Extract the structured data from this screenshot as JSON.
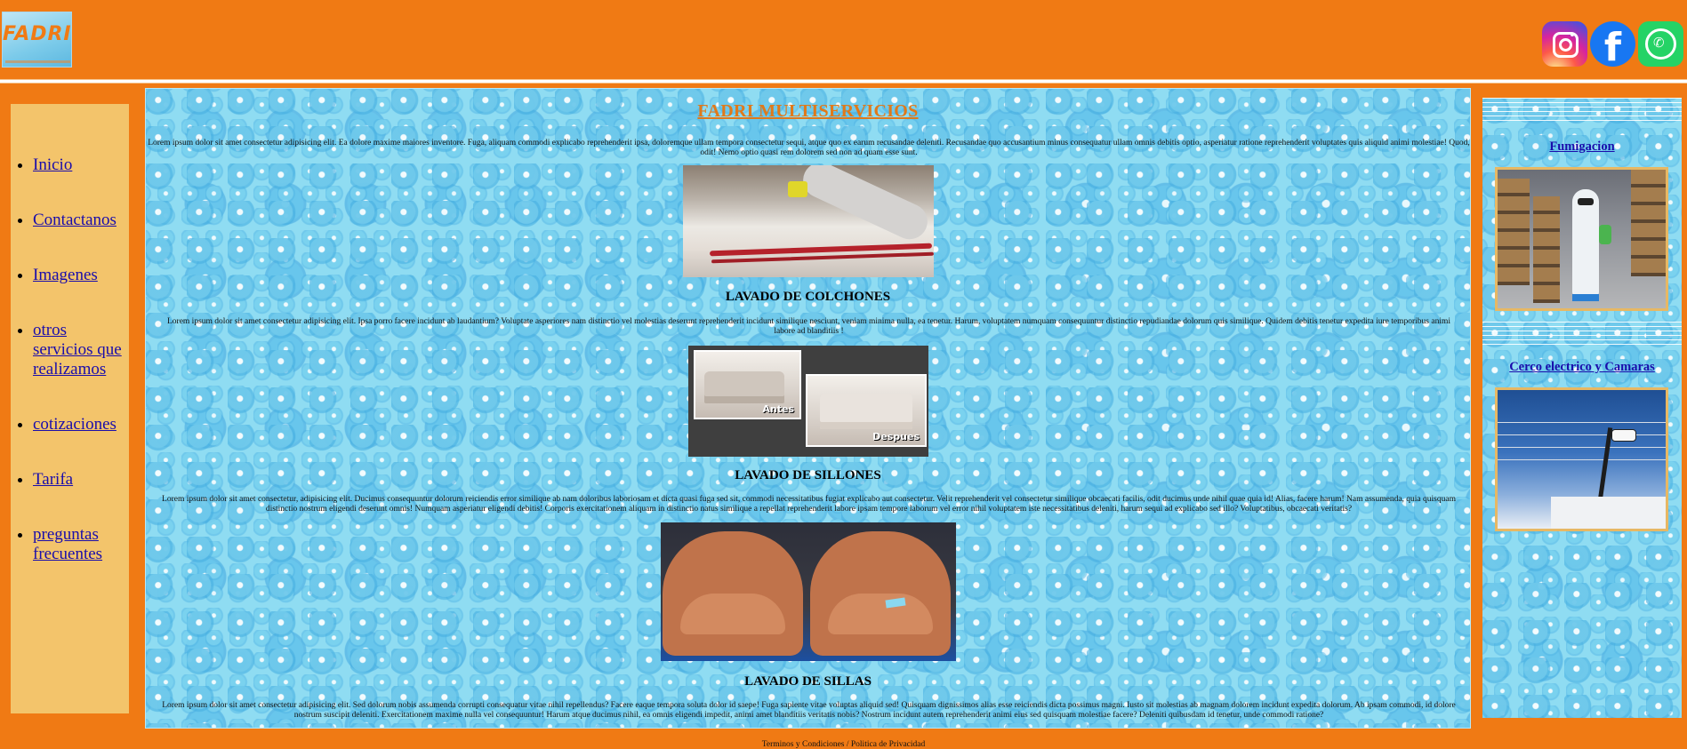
{
  "header": {
    "logo_text": "FADRI",
    "logo_icon": "fadri-logo-icon",
    "social": [
      {
        "name": "instagram",
        "icon": "instagram-icon"
      },
      {
        "name": "facebook",
        "icon": "facebook-icon"
      },
      {
        "name": "whatsapp",
        "icon": "whatsapp-icon"
      }
    ]
  },
  "nav": {
    "items": [
      {
        "label": "Inicio"
      },
      {
        "label": "Contactanos"
      },
      {
        "label": "Imagenes"
      },
      {
        "label": "otros servicios que realizamos"
      },
      {
        "label": "cotizaciones"
      },
      {
        "label": "Tarifa"
      },
      {
        "label": "preguntas frecuentes"
      }
    ]
  },
  "main": {
    "title": "FADRI MULTISERVICIOS",
    "intro": "Lorem ipsum dolor sit amet consectetur adipisicing elit. Ea dolore maxime maiores inventore. Fuga, aliquam commodi explicabo reprehenderit ipsa, doloremque ullam tempora consectetur sequi, atque quo ex earum recusandae deleniti. Recusandae quo accusantium minus consequatur ullam omnis debitis optio, asperiatur ratione reprehenderit voluptates quis aliquid animi molestiae! Quod, odit! Nemo optio quasi rem dolorem sed non ad quam esse sunt.",
    "services": [
      {
        "title": "LAVADO DE COLCHONES",
        "text": "Lorem ipsum dolor sit amet consectetur adipisicing elit. Ipsa porro facere incidunt ab laudantium? Voluptate asperiores nam distinctio vel molestias deserunt reprehenderit incidunt similique nesciunt, veniam minima nulla, ea tenetur. Harum, voluptatem numquam consequuntur distinctio repudiandae dolorum quis similique. Quidem debitis tenetur expedita iure temporibus animi labore ad blanditiis !"
      },
      {
        "title": "LAVADO DE SILLONES",
        "text": "Lorem ipsum dolor sit amet consectetur, adipisicing elit. Ducimus consequuntur dolorum reiciendis error similique ab nam doloribus laboriosam et dicta quasi fuga sed sit, commodi necessitatibus fugiat explicabo aut consectetur. Velit reprehenderit vel consectetur similique obcaecati facilis, odit ducimus unde nihil quae quia id! Alias, facere harum! Nam assumenda, quia quisquam distinctio nostrum eligendi deserunt omnis! Numquam asperiatur eligendi debitis! Corporis exercitationem aliquam in distinctio natus similique a repellat reprehenderit labore ipsam tempore laborum vel error nihil voluptatem iste necessitatibus deleniti, harum sequi ad explicabo sed illo? Voluptatibus, obcaecati veritatis?",
        "before_label": "Antes",
        "after_label": "Despues"
      },
      {
        "title": "LAVADO DE SILLAS",
        "text": "Lorem ipsum dolor sit amet consectetur adipisicing elit. Sed dolorum nobis assumenda corrupti consequatur vitae nihil repellendus? Facere eaque tempora soluta dolor id saepe! Fuga sapiente vitae voluptas aliquid sed! Quisquam dignissimos alias esse reiciendis dicta possimus magni. Iusto sit molestias ab magnam dolorem incidunt expedita dolorum. Ab ipsam commodi, id dolore nostrum suscipit deleniti. Exercitationem maxime nulla vel consequuntur! Harum atque ducimus nihil, ea omnis eligendi impedit, animi amet blanditiis veritatis nobis? Nostrum incidunt autem reprehenderit animi eius sed quisquam molestiae facere? Deleniti quibusdam id tenetur, unde commodi ratione?"
      }
    ]
  },
  "right": {
    "items": [
      {
        "label": "Fumigacion"
      },
      {
        "label": "Cerco electrico y Camaras"
      }
    ]
  },
  "footer": {
    "text": "Terminos y Condiciones / Politica de Privacidad"
  },
  "colors": {
    "brand_orange": "#f07a14",
    "sidebar_bg": "#f3c46b",
    "title_orange": "#e0791a",
    "link_blue": "#1a0dab"
  }
}
